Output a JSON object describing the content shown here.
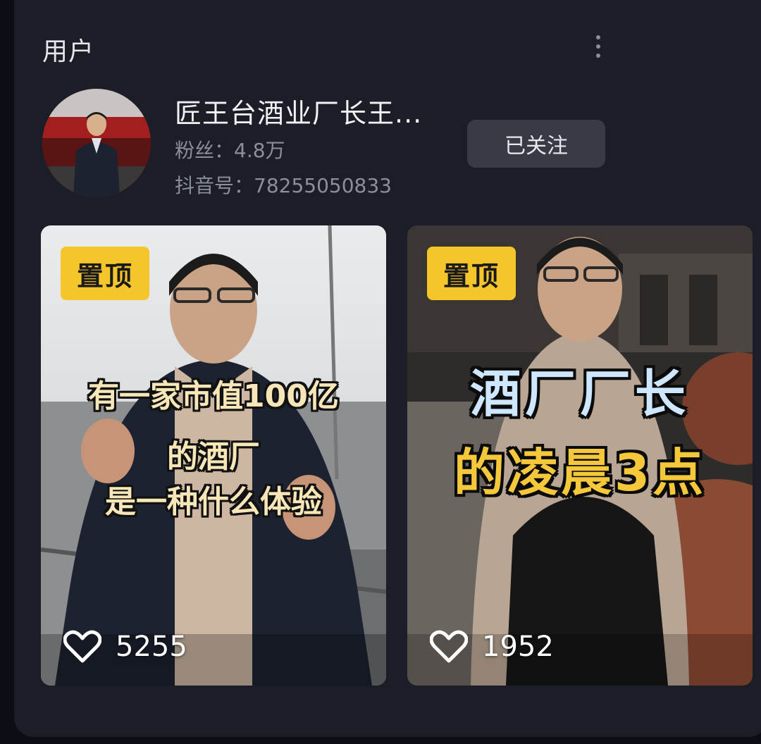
{
  "section": {
    "title": "用户"
  },
  "user": {
    "name": "匠王台酒业厂长王...",
    "followers": "粉丝：4.8万",
    "douyin_id": "抖音号：78255050833",
    "follow_label": "已关注"
  },
  "videos": [
    {
      "pin_label": "置顶",
      "caption_lines": [
        "有一家市值100亿",
        "的酒厂",
        "是一种什么体验"
      ],
      "likes": "5255"
    },
    {
      "pin_label": "置顶",
      "caption_lines": [
        "酒厂厂长",
        "的凌晨3点"
      ],
      "likes": "1952"
    }
  ],
  "icons": {
    "more": "more-vertical-icon",
    "like": "heart-outline-icon"
  },
  "colors": {
    "card_bg": "#1b1d27",
    "pin_badge": "#f5c52c",
    "follow_button": "#383b46"
  }
}
